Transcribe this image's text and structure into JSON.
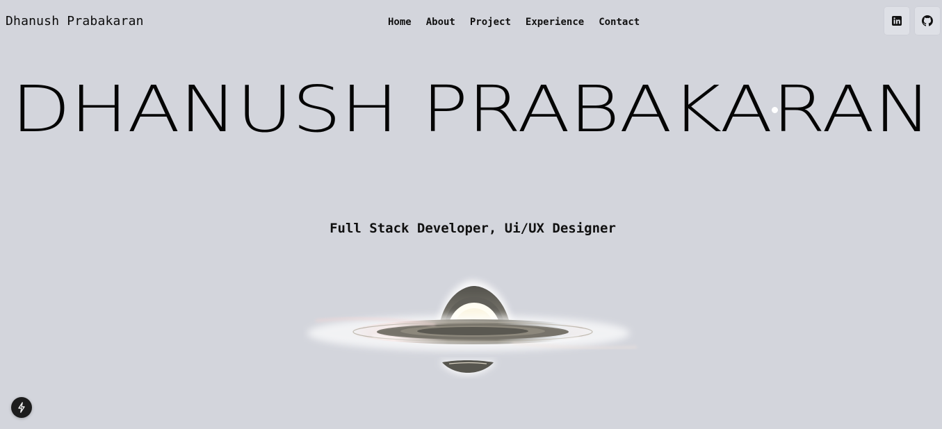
{
  "header": {
    "brand": "Dhanush Prabakaran",
    "nav": [
      {
        "label": "Home"
      },
      {
        "label": "About"
      },
      {
        "label": "Project"
      },
      {
        "label": "Experience"
      },
      {
        "label": "Contact"
      }
    ],
    "social": [
      {
        "icon": "linkedin-icon"
      },
      {
        "icon": "github-icon"
      }
    ]
  },
  "hero": {
    "title": "DHANUSH PRABAKARAN",
    "subtitle": "Full Stack Developer, Ui/UX Designer",
    "visual": "black-hole-illustration"
  },
  "floating_button": {
    "icon": "lightning-bolt-icon"
  },
  "colors": {
    "background": "#d3d5dc",
    "text": "#0b0b0b",
    "fab": "#1d1d1d"
  }
}
